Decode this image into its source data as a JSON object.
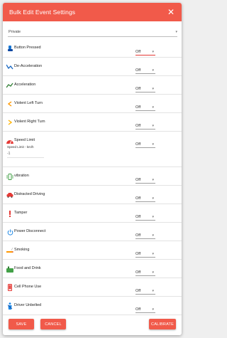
{
  "dialog": {
    "title": "Bulk Edit Event Settings",
    "close_glyph": "✕"
  },
  "privacy": {
    "value": "Private",
    "caret": "▾"
  },
  "speed_limit": {
    "sub_label": "Speed Limit - km/h",
    "input_value": "-1"
  },
  "rows": [
    {
      "label": "Button Pressed",
      "value": "Off",
      "icon": "button-pressed-icon",
      "color": "#1976d2"
    },
    {
      "label": "De-Acceleration",
      "value": "Off",
      "icon": "deceleration-icon",
      "color": "#1565c0"
    },
    {
      "label": "Acceleration",
      "value": "Off",
      "icon": "acceleration-icon",
      "color": "#2e7d32"
    },
    {
      "label": "Violent Left Turn",
      "value": "Off",
      "icon": "left-turn-icon",
      "color": "#ff9800"
    },
    {
      "label": "Violent Right Turn",
      "value": "Off",
      "icon": "right-turn-icon",
      "color": "#ffb300"
    },
    {
      "label": "Speed Limit",
      "value": "Off",
      "icon": "speedometer-icon",
      "color": "#e53935"
    },
    {
      "label": "vibration",
      "value": "Off",
      "icon": "vibration-icon",
      "color": "#43a047"
    },
    {
      "label": "Distracted Driving",
      "value": "Off",
      "icon": "car-icon",
      "color": "#e53935"
    },
    {
      "label": "Tamper",
      "value": "Off",
      "icon": "exclamation-icon",
      "color": "#e53935"
    },
    {
      "label": "Power Disconnect",
      "value": "Off",
      "icon": "power-icon",
      "color": "#1e88e5"
    },
    {
      "label": "Smoking",
      "value": "Off",
      "icon": "smoking-icon",
      "color": "#ff9800"
    },
    {
      "label": "Food and Drink",
      "value": "Off",
      "icon": "food-icon",
      "color": "#43a047"
    },
    {
      "label": "Cell Phone Use",
      "value": "Off",
      "icon": "phone-icon",
      "color": "#e53935"
    },
    {
      "label": "Driver Unbelted",
      "value": "Off",
      "icon": "seatbelt-icon",
      "color": "#1e88e5"
    }
  ],
  "footer": {
    "save": "SAVE",
    "cancel": "CANCEL",
    "calibrate": "CALIBRATE"
  },
  "colors": {
    "accent": "#f15a4a",
    "active_underline": "#e53935"
  }
}
